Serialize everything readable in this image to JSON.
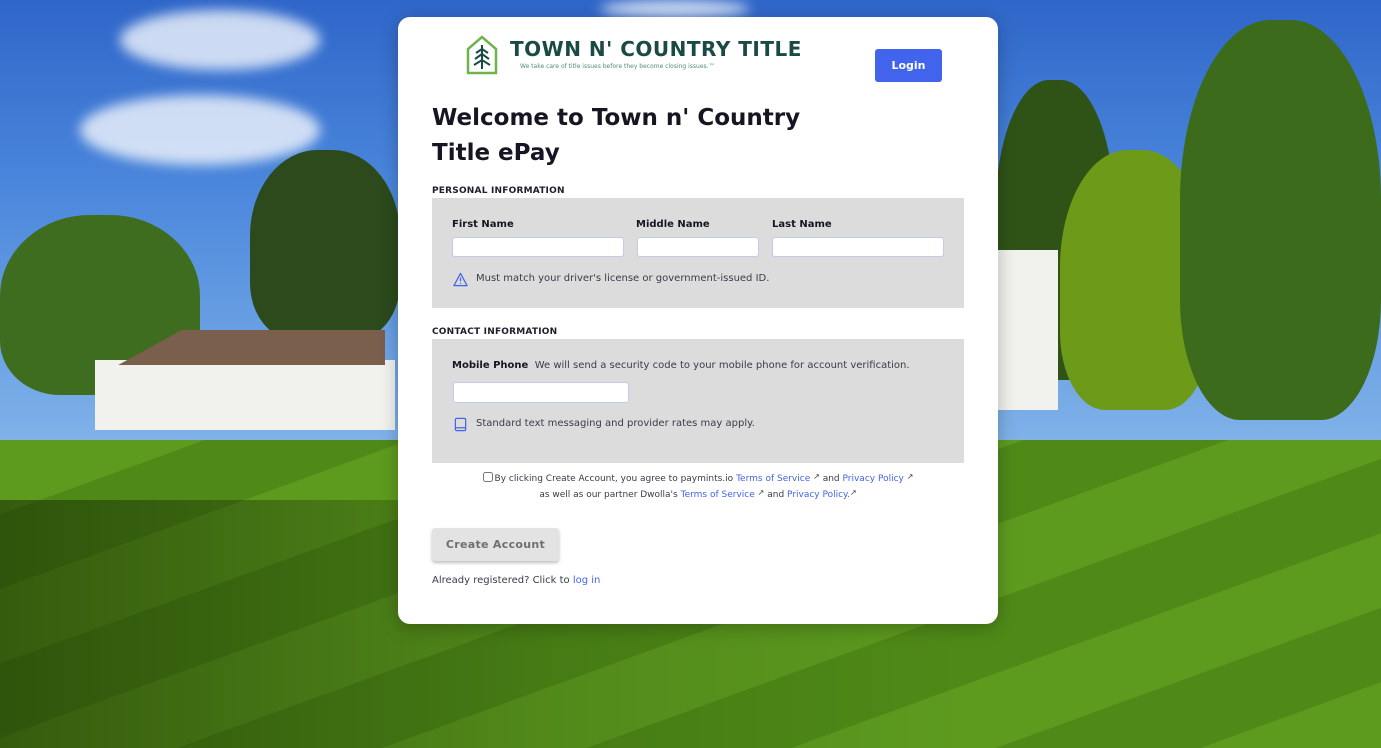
{
  "brand": {
    "name": "TOWN N' COUNTRY TITLE",
    "tagline": "We take care of title issues before they become closing issues.™",
    "accent_color": "#4263eb",
    "logo_color": "#1b4a45"
  },
  "header": {
    "login_label": "Login"
  },
  "page": {
    "title": "Welcome to Town n' Country Title ePay"
  },
  "personal": {
    "section_label": "PERSONAL INFORMATION",
    "first_name_label": "First Name",
    "middle_name_label": "Middle Name",
    "last_name_label": "Last Name",
    "first_name_value": "",
    "middle_name_value": "",
    "last_name_value": "",
    "warning_icon": "warning-triangle-icon",
    "note": "Must match your driver's license or government-issued ID."
  },
  "contact": {
    "section_label": "CONTACT INFORMATION",
    "mobile_label": "Mobile Phone",
    "mobile_hint": "We will send a security code to your mobile phone for account verification.",
    "mobile_value": "",
    "phone_icon": "mobile-phone-icon",
    "note": "Standard text messaging and provider rates may apply."
  },
  "consent": {
    "checked": false,
    "text_1": "By clicking Create Account, you agree to paymints.io",
    "tos_1": "Terms of Service",
    "and_1": "and",
    "privacy_1": "Privacy Policy",
    "text_2": "as well as our partner Dwolla's",
    "tos_2": "Terms of Service",
    "and_2": "and",
    "privacy_2": "Privacy Policy.",
    "external_icon": "external-link-icon"
  },
  "actions": {
    "create_label": "Create Account",
    "already_text": "Already registered? Click to",
    "login_link": "log in"
  }
}
